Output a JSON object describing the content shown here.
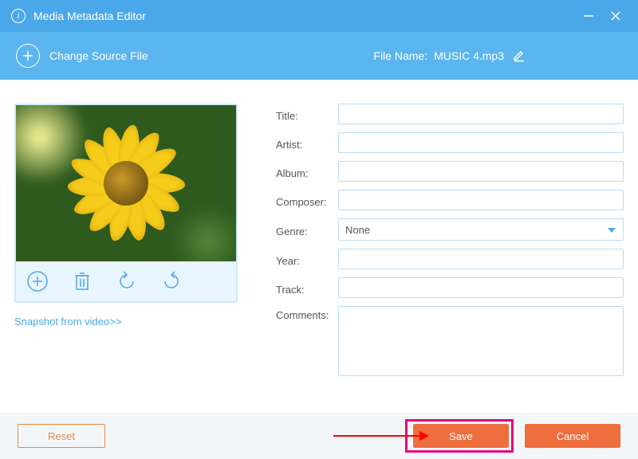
{
  "window": {
    "title": "Media Metadata Editor"
  },
  "toolbar": {
    "change_source_label": "Change Source File",
    "filename_label": "File Name:",
    "filename_value": "MUSIC 4.mp3"
  },
  "left": {
    "snapshot_link": "Snapshot from video>>"
  },
  "fields": {
    "title_label": "Title:",
    "title_value": "",
    "artist_label": "Artist:",
    "artist_value": "",
    "album_label": "Album:",
    "album_value": "",
    "composer_label": "Composer:",
    "composer_value": "",
    "genre_label": "Genre:",
    "genre_selected": "None",
    "year_label": "Year:",
    "year_value": "",
    "track_label": "Track:",
    "track_value": "",
    "comments_label": "Comments:",
    "comments_value": ""
  },
  "footer": {
    "reset_label": "Reset",
    "save_label": "Save",
    "cancel_label": "Cancel"
  },
  "colors": {
    "primary": "#4ba8e8",
    "accent": "#ee6e3d",
    "highlight": "#e4007f"
  }
}
